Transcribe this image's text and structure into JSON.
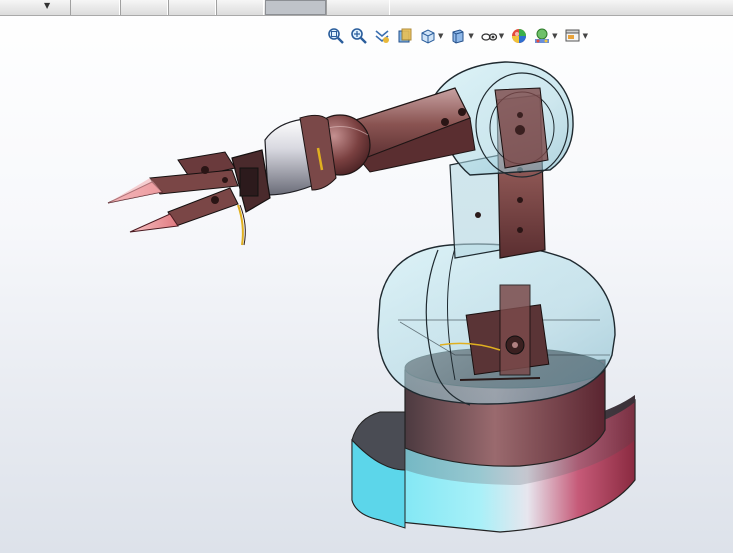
{
  "window": {
    "tabs": [
      {
        "name": "tab-1",
        "active": false
      },
      {
        "name": "tab-2",
        "active": false
      },
      {
        "name": "tab-3",
        "active": false
      },
      {
        "name": "tab-4",
        "active": false
      },
      {
        "name": "tab-5",
        "active": true
      },
      {
        "name": "tab-6",
        "active": false
      }
    ]
  },
  "heads_up_toolbar": {
    "tools": [
      {
        "icon": "zoom-to-fit-icon",
        "has_dropdown": false
      },
      {
        "icon": "zoom-to-area-icon",
        "has_dropdown": false
      },
      {
        "icon": "previous-view-icon",
        "has_dropdown": false
      },
      {
        "icon": "section-view-icon",
        "has_dropdown": false
      },
      {
        "icon": "view-orientation-icon",
        "has_dropdown": true
      },
      {
        "icon": "display-style-icon",
        "has_dropdown": true
      },
      {
        "icon": "hide-show-items-icon",
        "has_dropdown": true
      },
      {
        "icon": "edit-appearance-icon",
        "has_dropdown": false
      },
      {
        "icon": "apply-scene-icon",
        "has_dropdown": true
      },
      {
        "icon": "view-settings-icon",
        "has_dropdown": true
      }
    ]
  },
  "model": {
    "name": "robotic-arm-assembly",
    "colors": {
      "arm_primary": "#7e4a48",
      "arm_highlight": "#b98a88",
      "transparent_shell": "#9fd8e6",
      "base_cyan": "#5fd8ec",
      "base_magenta": "#b03a5a",
      "gripper_tip": "#f1a5a8",
      "cable": "#e0b020"
    }
  }
}
